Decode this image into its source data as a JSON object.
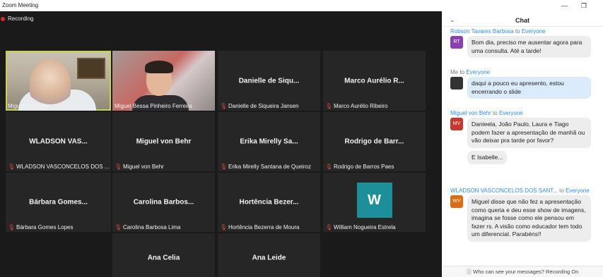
{
  "window": {
    "title": "Zoom Meeting"
  },
  "meeting": {
    "recording_label": "Recording"
  },
  "tiles": [
    {
      "name": "Miguel von Behr",
      "center": "",
      "muted": false
    },
    {
      "name": "Miguel Bessa Pinheiro Ferreira",
      "center": "",
      "muted": false
    },
    {
      "name": "Danielle de Siqueira Jansen",
      "center": "Danielle de Siqu...",
      "muted": true
    },
    {
      "name": "Marco Aurélio Ribeiro",
      "center": "Marco Aurélio R...",
      "muted": true
    },
    {
      "name": "WLADSON VASCONCELOS DOS ...",
      "center": "WLADSON VAS...",
      "muted": true
    },
    {
      "name": "Miguel von Behr",
      "center": "Miguel von Behr",
      "muted": true
    },
    {
      "name": "Erika Mirelly Santana de Queiroz",
      "center": "Erika Mirelly Sa...",
      "muted": true
    },
    {
      "name": "Rodrigo de Barros Paes",
      "center": "Rodrigo de Barr...",
      "muted": true
    },
    {
      "name": "Bárbara Gomes Lopes",
      "center": "Bárbara Gomes...",
      "muted": true
    },
    {
      "name": "Carolina Barbosa Lima",
      "center": "Carolina Barbos...",
      "muted": true
    },
    {
      "name": "Hortência Bezerra de Moura",
      "center": "Hortência Bezer...",
      "muted": true
    },
    {
      "name": "William Nogueira Estrela",
      "center": "",
      "avatar_letter": "W",
      "muted": true
    },
    {
      "name": "",
      "center": "Ana Celia",
      "muted": false
    },
    {
      "name": "",
      "center": "Ana Leide",
      "muted": false
    }
  ],
  "chat": {
    "title": "Chat",
    "messages": [
      {
        "sender": "Robson Tavares Barbosa",
        "to_word": "to",
        "recipient": "Everyone",
        "initials": "RT",
        "color": "#8a3fb0",
        "texts": [
          "Bom dia, preciso me ausentar agora para uma consulta. Até a tarde!"
        ]
      },
      {
        "sender": "Me",
        "to_word": "to",
        "recipient": "Everyone",
        "initials": "",
        "color": "#333333",
        "texts": [
          "daqui a pouco eu apresento, estou encerrando o slide"
        ]
      },
      {
        "sender": "Miguel von Behr",
        "to_word": "to",
        "recipient": "Everyone",
        "initials": "MV",
        "color": "#c8372d",
        "texts": [
          "Danieela,  João Paulo, Laura e Tiago podem fazer a apresentação de manhã ou vão deixar pra tarde por favor?",
          "E Isabelle..."
        ]
      },
      {
        "sender": "WLADSON VASCONCELOS DOS SANT...",
        "to_word": "to",
        "recipient": "Everyone",
        "initials": "WV",
        "color": "#e06a12",
        "texts": [
          "Miguel disse que não fez a apresentação como queria e deu esse show de imagens, imagina se fosse como ele pensou em fazer rs. A visão como educador tem todo um diferencial. Parabéns!!"
        ]
      }
    ],
    "footer": "Who can see your messages? Recording On"
  }
}
